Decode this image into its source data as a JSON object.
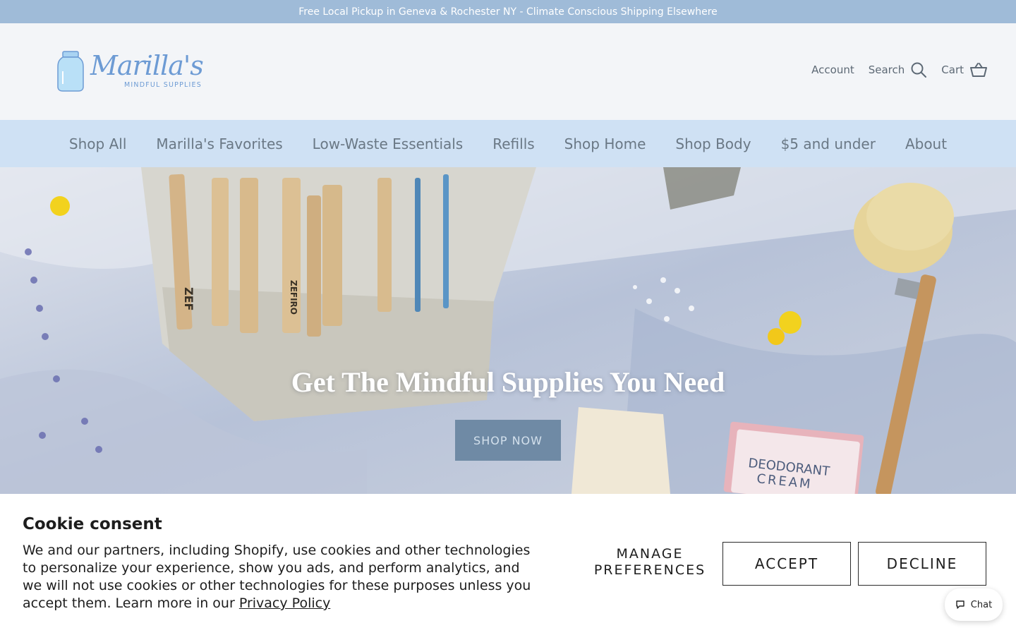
{
  "announcement": "Free Local Pickup in Geneva & Rochester NY - Climate Conscious Shipping Elsewhere",
  "brand": {
    "name": "Marilla's",
    "tagline": "MINDFUL SUPPLIES"
  },
  "header_links": {
    "account": "Account",
    "search": "Search",
    "cart": "Cart"
  },
  "nav": [
    "Shop All",
    "Marilla's Favorites",
    "Low-Waste Essentials",
    "Refills",
    "Shop Home",
    "Shop Body",
    "$5 and under",
    "About"
  ],
  "hero": {
    "heading": "Get The Mindful Supplies You Need",
    "button": "SHOP NOW",
    "product_labels": [
      "ZEFIRO",
      "ZEF",
      "DEODORANT",
      "CREAM"
    ]
  },
  "cookie_consent": {
    "title": "Cookie consent",
    "body": "We and our partners, including Shopify, use cookies and other technologies to personalize your experience, show you ads, and perform analytics, and we will not use cookies or other technologies for these purposes unless you accept them. Learn more in our",
    "link": "Privacy Policy",
    "manage_line1": "MANAGE",
    "manage_line2": "PREFERENCES",
    "accept": "ACCEPT",
    "decline": "DECLINE"
  },
  "chat": {
    "label": "Chat"
  },
  "icons": {
    "search": "search-icon",
    "cart": "cart-icon",
    "chat": "chat-icon",
    "logo": "mason-jar-icon"
  },
  "colors": {
    "announcement_bg": "#9fbbd8",
    "nav_bg": "#cfe1f4",
    "brand_blue": "#6d9bd4",
    "hero_button": "#6f8aa5"
  }
}
